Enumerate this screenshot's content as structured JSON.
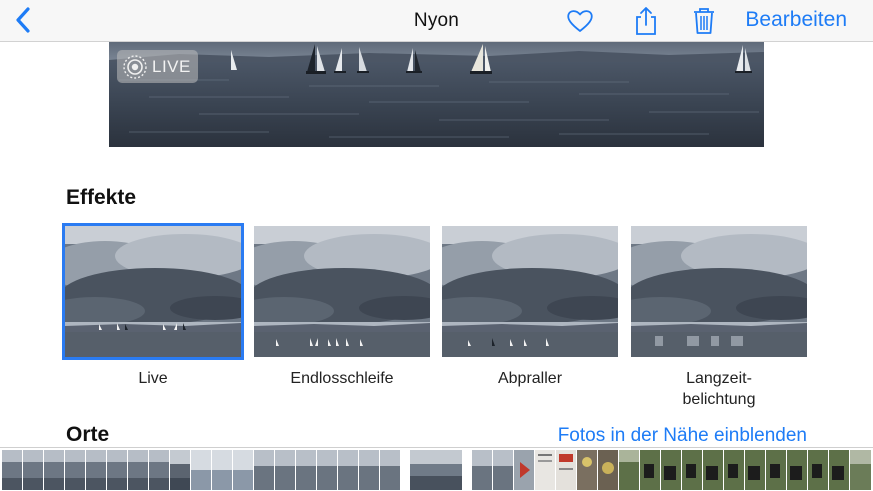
{
  "navbar": {
    "title": "Nyon",
    "edit_label": "Bearbeiten",
    "back_icon": "chevron-left-icon",
    "favorite_icon": "heart-icon",
    "share_icon": "share-icon",
    "delete_icon": "trash-icon"
  },
  "photo": {
    "live_label": "LIVE"
  },
  "effects": {
    "title": "Effekte",
    "items": [
      {
        "label": "Live",
        "selected": true
      },
      {
        "label": "Endlosschleife",
        "selected": false
      },
      {
        "label": "Abpraller",
        "selected": false
      },
      {
        "label": "Langzeit-\nbelichtung",
        "selected": false
      }
    ]
  },
  "places": {
    "title": "Orte",
    "link_label": "Fotos in der Nähe einblenden"
  },
  "colors": {
    "accent": "#1e7cf6",
    "selection": "#2a7bf2"
  }
}
